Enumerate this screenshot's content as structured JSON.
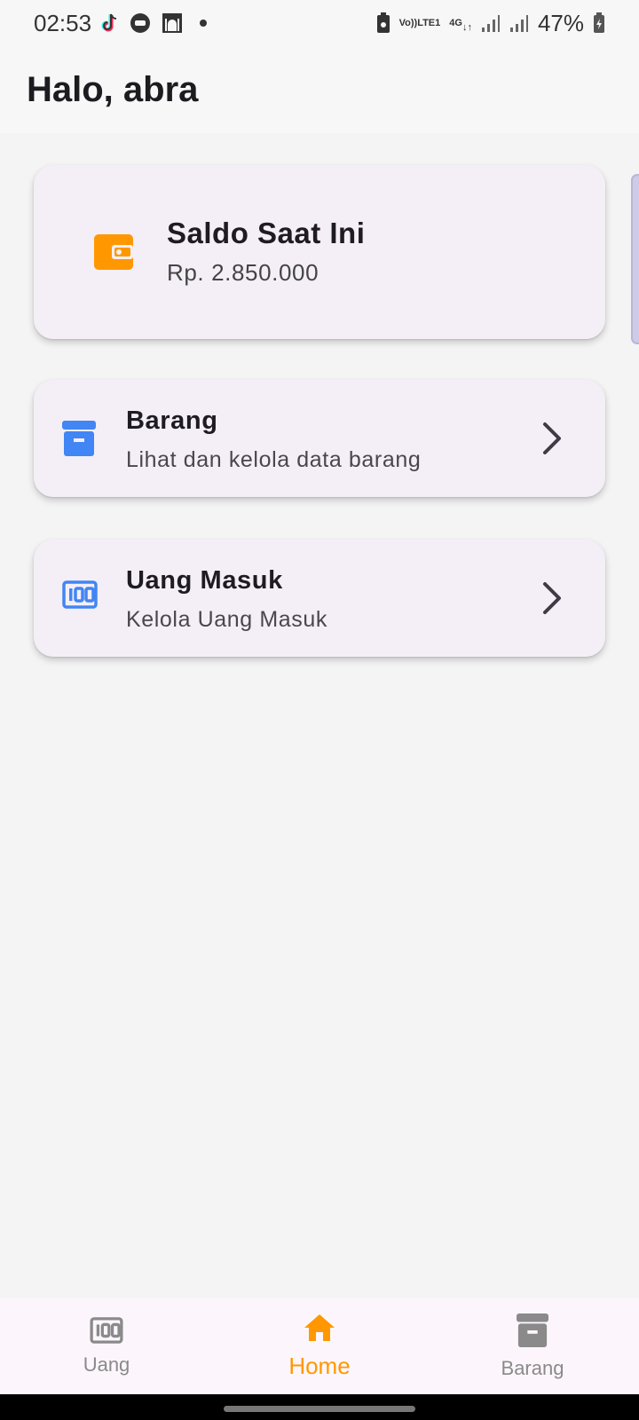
{
  "status_bar": {
    "time": "02:53",
    "lte_top": "Vo))",
    "lte_bottom": "LTE1",
    "network": "4G",
    "battery": "47%"
  },
  "header": {
    "title": "Halo, abra"
  },
  "balance": {
    "title": "Saldo Saat Ini",
    "value": "Rp. 2.850.000",
    "icon": "wallet-icon",
    "icon_color": "#ff9800"
  },
  "menu": [
    {
      "title": "Barang",
      "subtitle": "Lihat dan kelola data barang",
      "icon": "archive-box-icon",
      "icon_color": "#4285f4"
    },
    {
      "title": "Uang Masuk",
      "subtitle": "Kelola Uang Masuk",
      "icon": "money-100-icon",
      "icon_color": "#4285f4"
    }
  ],
  "bottom_nav": {
    "items": [
      {
        "label": "Uang",
        "icon": "money-100-icon",
        "active": false
      },
      {
        "label": "Home",
        "icon": "home-icon",
        "active": true
      },
      {
        "label": "Barang",
        "icon": "archive-box-icon",
        "active": false
      }
    ],
    "active_color": "#ff9800",
    "inactive_color": "#8a8a8a"
  }
}
